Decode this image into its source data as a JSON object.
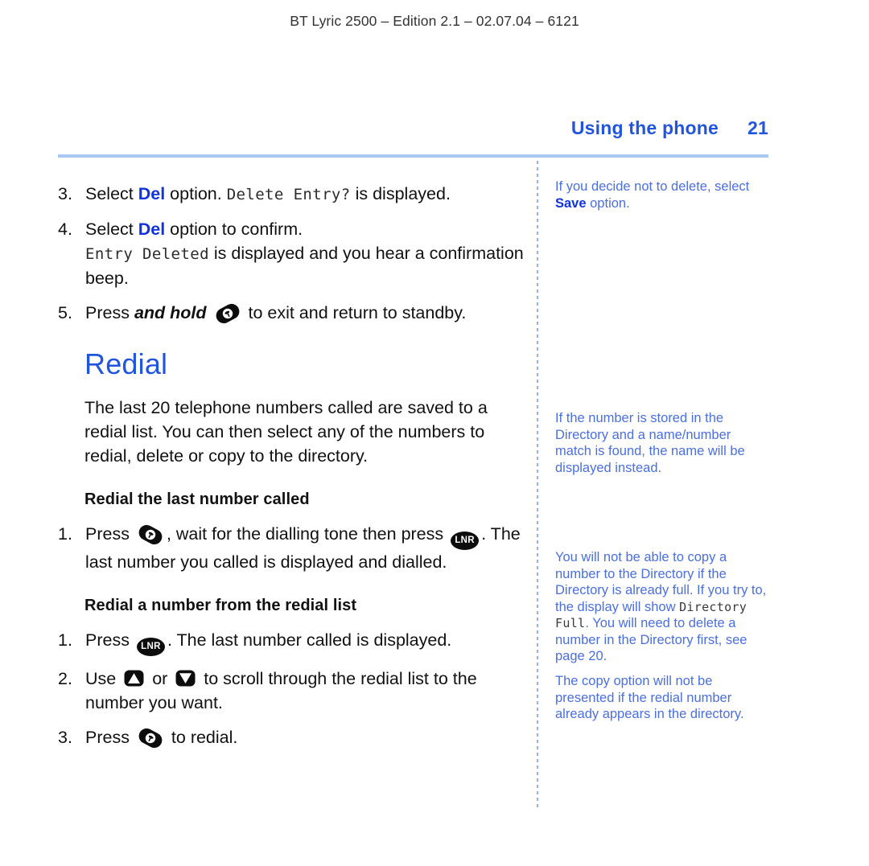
{
  "header": {
    "running_head": "BT Lyric 2500 – Edition 2.1 – 02.07.04 – 6121"
  },
  "section": {
    "title": "Using the phone",
    "page_number": "21"
  },
  "colors": {
    "heading_blue": "#2255dd",
    "accent_blue": "#1133dd",
    "note_blue": "#4a6fe0",
    "rule_blue": "#a9c9f2",
    "body_black": "#111111"
  },
  "main": {
    "delete_steps": [
      {
        "num": "3.",
        "parts": [
          {
            "text": "Select ",
            "style": "plain"
          },
          {
            "text": "Del",
            "style": "blue-bold"
          },
          {
            "text": " option. ",
            "style": "plain"
          },
          {
            "text": "Delete Entry?",
            "style": "lcd"
          },
          {
            "text": " is displayed.",
            "style": "plain"
          }
        ]
      },
      {
        "num": "4.",
        "parts": [
          {
            "text": "Select ",
            "style": "plain"
          },
          {
            "text": "Del",
            "style": "blue-bold"
          },
          {
            "text": " option to confirm.",
            "style": "plain"
          },
          {
            "text": "BREAK",
            "style": "break"
          },
          {
            "text": "Entry Deleted",
            "style": "lcd"
          },
          {
            "text": " is displayed and you hear a confirmation beep.",
            "style": "plain"
          }
        ]
      },
      {
        "num": "5.",
        "parts": [
          {
            "text": "Press ",
            "style": "plain"
          },
          {
            "text": "and hold",
            "style": "ital-bold"
          },
          {
            "text": " ",
            "style": "plain"
          },
          {
            "text": "end-call-key-icon",
            "style": "icon"
          },
          {
            "text": " to exit and return to standby.",
            "style": "plain"
          }
        ]
      }
    ],
    "redial_heading": "Redial",
    "redial_intro": "The last 20 telephone numbers called are saved to a redial list. You can then select any of the numbers to redial, delete or copy to the directory.",
    "subhead_1": "Redial the last number called",
    "subhead_1_steps": [
      {
        "num": "1.",
        "parts": [
          {
            "text": "Press ",
            "style": "plain"
          },
          {
            "text": "talk-key-icon",
            "style": "icon"
          },
          {
            "text": ", wait for the dialling tone then press ",
            "style": "plain"
          },
          {
            "text": "lnr-key-icon",
            "style": "icon"
          },
          {
            "text": ". The last number you called is displayed and dialled.",
            "style": "plain"
          }
        ]
      }
    ],
    "subhead_2": "Redial a number from the redial list",
    "subhead_2_steps": [
      {
        "num": "1.",
        "parts": [
          {
            "text": "Press ",
            "style": "plain"
          },
          {
            "text": "lnr-key-icon",
            "style": "icon"
          },
          {
            "text": ". The last number called is displayed.",
            "style": "plain"
          }
        ]
      },
      {
        "num": "2.",
        "parts": [
          {
            "text": "Use ",
            "style": "plain"
          },
          {
            "text": "up-arrow-key-icon",
            "style": "icon"
          },
          {
            "text": " or ",
            "style": "plain"
          },
          {
            "text": "down-arrow-key-icon",
            "style": "icon"
          },
          {
            "text": " to scroll through the redial list to the number you want.",
            "style": "plain"
          }
        ]
      },
      {
        "num": "3.",
        "parts": [
          {
            "text": "Press ",
            "style": "plain"
          },
          {
            "text": "talk-key-icon",
            "style": "icon"
          },
          {
            "text": " to redial.",
            "style": "plain"
          }
        ]
      }
    ]
  },
  "icons": {
    "lnr_label": "LNR"
  },
  "side_notes": [
    {
      "id": "note-save",
      "segments": [
        {
          "text": "If you decide not to delete, select ",
          "style": "plain"
        },
        {
          "text": "Save",
          "style": "strongblue"
        },
        {
          "text": " option.",
          "style": "plain"
        }
      ]
    },
    {
      "id": "note-directory-match",
      "segments": [
        {
          "text": "If the number is stored in the Directory and a name/number match is found, the name will be displayed instead.",
          "style": "plain"
        }
      ]
    },
    {
      "id": "note-directory-full",
      "segments": [
        {
          "text": "You will not be able to copy a number to the Directory if the Directory is already full. If you try to, the display will show ",
          "style": "plain"
        },
        {
          "text": "Directory Full",
          "style": "lcd-sm"
        },
        {
          "text": ". You will need to delete a number in the Directory first, see page 20.",
          "style": "plain"
        }
      ]
    },
    {
      "id": "note-copy-option",
      "segments": [
        {
          "text": "The copy option will not be presented if the redial number already appears in the directory.",
          "style": "plain"
        }
      ]
    }
  ]
}
